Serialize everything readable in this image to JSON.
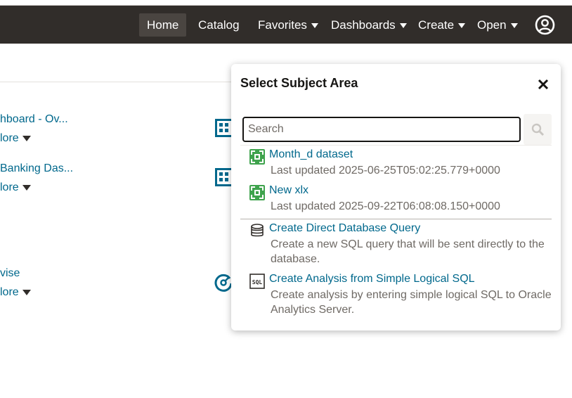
{
  "nav": {
    "items": [
      {
        "label": "Home",
        "active": true,
        "dropdown": false
      },
      {
        "label": "Catalog",
        "active": false,
        "dropdown": false
      },
      {
        "label": "Favorites",
        "active": false,
        "dropdown": true
      },
      {
        "label": "Dashboards",
        "active": false,
        "dropdown": true
      },
      {
        "label": "Create",
        "active": false,
        "dropdown": true
      },
      {
        "label": "Open",
        "active": false,
        "dropdown": true
      }
    ],
    "user_icon": "user-circle-icon"
  },
  "background": {
    "items": [
      {
        "title": "hboard - Ov...",
        "more": "lore",
        "icon": "dashboard-grid-icon"
      },
      {
        "title": "Banking Das...",
        "more": "lore",
        "icon": "dashboard-grid-icon"
      },
      {
        "title": "vise",
        "more": "lore",
        "icon": "gauge-icon"
      }
    ]
  },
  "popup": {
    "title": "Select Subject Area",
    "close_icon": "close-icon",
    "search": {
      "placeholder": "Search",
      "value": ""
    },
    "datasets": [
      {
        "title": "Month_d dataset",
        "subtitle": "Last updated 2025-06-25T05:02:25.779+0000",
        "icon": "dataset-icon"
      },
      {
        "title": "New xlx",
        "subtitle": "Last updated 2025-09-22T06:08:08.150+0000",
        "icon": "dataset-icon"
      }
    ],
    "actions": [
      {
        "title": "Create Direct Database Query",
        "subtitle": "Create a new SQL query that will be sent directly to the database.",
        "icon": "database-icon"
      },
      {
        "title": "Create Analysis from Simple Logical SQL",
        "subtitle": "Create analysis by entering simple logical SQL to Oracle Analytics Server.",
        "icon": "sql-icon"
      }
    ]
  },
  "colors": {
    "topbar": "#312d2a",
    "link": "#00688c",
    "secondary_text": "#6f6a65",
    "dataset_icon": "#3fa34d"
  }
}
